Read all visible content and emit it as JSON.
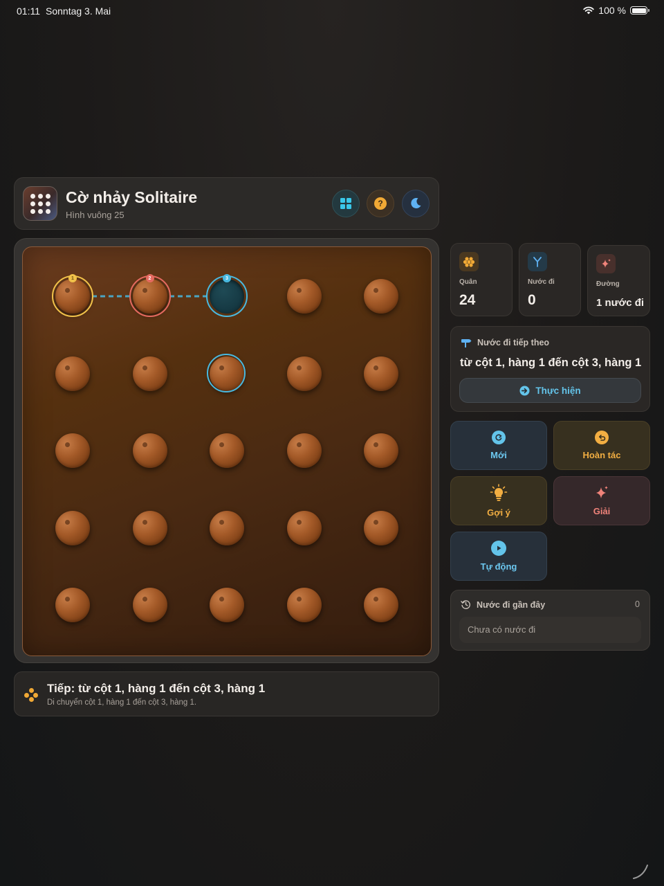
{
  "status_bar": {
    "time": "01:11",
    "date": "Sonntag 3. Mai",
    "battery": "100 %"
  },
  "header": {
    "title": "Cờ nhảy Solitaire",
    "subtitle": "Hình vuông 25",
    "icons": [
      "grid-icon",
      "help-icon",
      "moon-icon"
    ]
  },
  "board": {
    "rows": 5,
    "cols": 5,
    "layout": [
      [
        "peg",
        "peg",
        "empty",
        "peg",
        "peg"
      ],
      [
        "peg",
        "peg",
        "peg",
        "peg",
        "peg"
      ],
      [
        "peg",
        "peg",
        "peg",
        "peg",
        "peg"
      ],
      [
        "peg",
        "peg",
        "peg",
        "peg",
        "peg"
      ],
      [
        "peg",
        "peg",
        "peg",
        "peg",
        "peg"
      ]
    ],
    "highlight_badges": [
      "1",
      "2",
      "3"
    ],
    "colors": {
      "start": "#f1c24a",
      "jumped": "#e56a60",
      "target": "#49b9e0"
    }
  },
  "info": {
    "title": "Tiếp: từ cột 1, hàng 1 đến cột 3, hàng 1",
    "subtitle": "Di chuyển cột 1, hàng 1 đến cột 3, hàng 1."
  },
  "stats": [
    {
      "label": "Quân",
      "value": "24",
      "icon": "honeycomb-icon"
    },
    {
      "label": "Nước đi",
      "value": "0",
      "icon": "branch-icon"
    },
    {
      "label": "Đường",
      "value": "1 nước đi",
      "icon": "sparkle-icon"
    }
  ],
  "next_move": {
    "heading": "Nước đi tiếp theo",
    "text": "từ cột 1, hàng 1 đến cột 3, hàng 1",
    "button": "Thực hiện"
  },
  "actions": {
    "new": "Mới",
    "undo": "Hoàn tác",
    "hint": "Gợi ý",
    "solve": "Giải",
    "auto": "Tự động"
  },
  "recent": {
    "heading": "Nước đi gần đây",
    "count": "0",
    "empty": "Chưa có nước đi"
  }
}
